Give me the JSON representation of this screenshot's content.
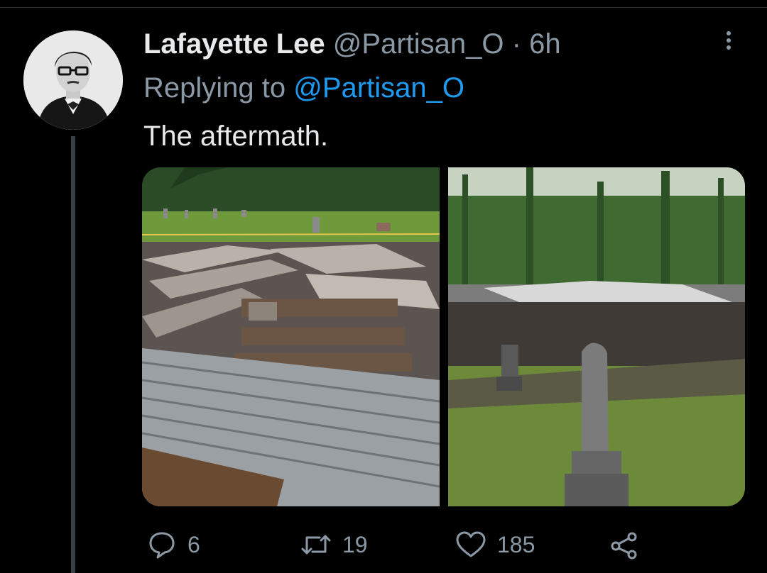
{
  "tweet": {
    "display_name": "Lafayette Lee",
    "handle": "@Partisan_O",
    "separator": "·",
    "time": "6h",
    "replying_prefix": "Replying to",
    "replying_to": "@Partisan_O",
    "text": "The aftermath."
  },
  "actions": {
    "replies": "6",
    "retweets": "19",
    "likes": "185"
  },
  "icons": {
    "reply": "speech-bubble",
    "retweet": "retweet-arrows",
    "like": "heart",
    "share": "share-nodes",
    "more": "vertical-dots"
  },
  "colors": {
    "background": "#000000",
    "primary_text": "#e7e9ea",
    "secondary_text": "#8b98a5",
    "link": "#1d9bf0"
  }
}
